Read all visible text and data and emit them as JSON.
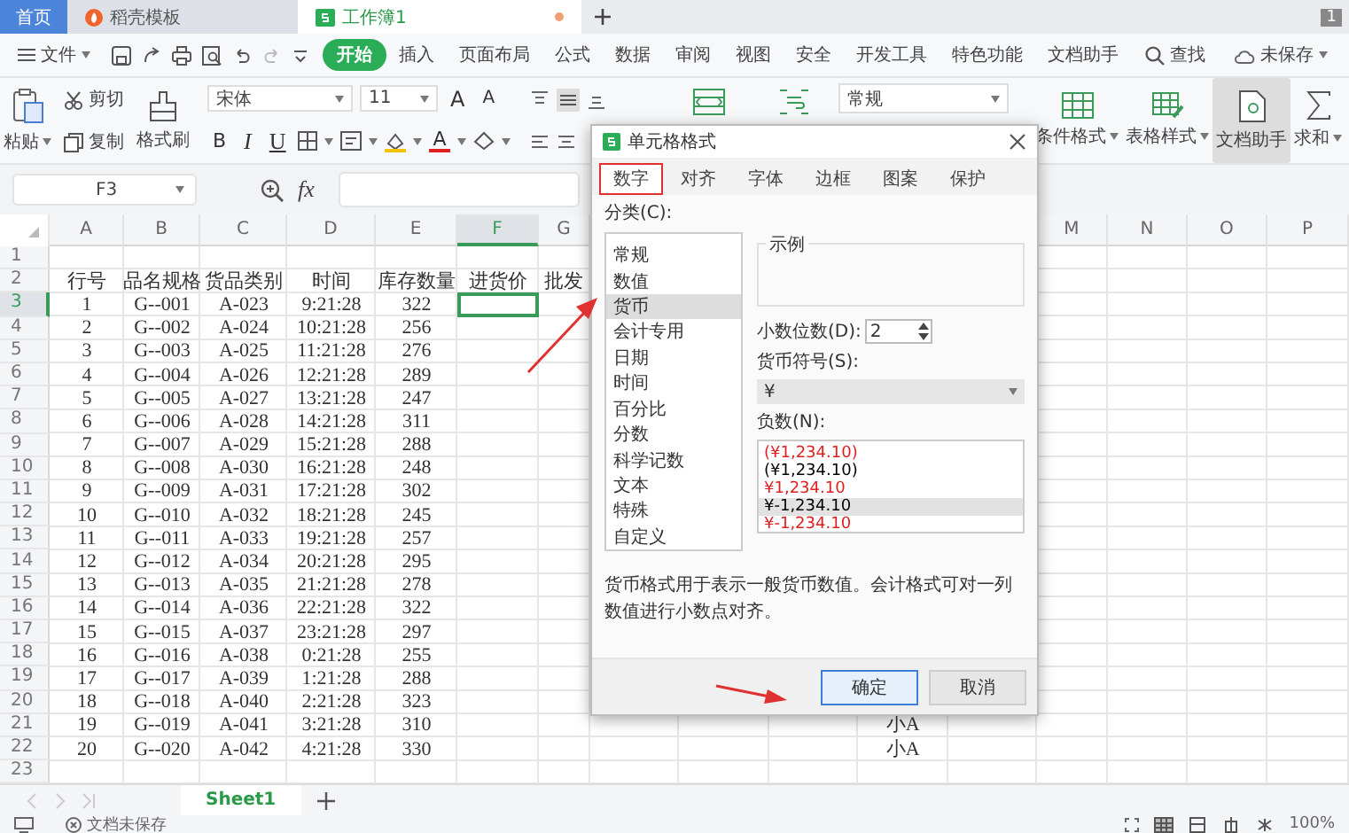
{
  "tabs": [
    {
      "label": "首页",
      "selected": false,
      "kind": "home"
    },
    {
      "label": "稻壳模板",
      "selected": false,
      "kind": "template"
    },
    {
      "label": "工作簿1",
      "selected": true,
      "kind": "sheet"
    }
  ],
  "window_badge": "1",
  "menu": {
    "file": "文件",
    "tabs": [
      {
        "label": "开始",
        "selected": true
      },
      {
        "label": "插入",
        "selected": false
      },
      {
        "label": "页面布局",
        "selected": false
      },
      {
        "label": "公式",
        "selected": false
      },
      {
        "label": "数据",
        "selected": false
      },
      {
        "label": "审阅",
        "selected": false
      },
      {
        "label": "视图",
        "selected": false
      },
      {
        "label": "安全",
        "selected": false
      },
      {
        "label": "开发工具",
        "selected": false
      },
      {
        "label": "特色功能",
        "selected": false
      },
      {
        "label": "文档助手",
        "selected": false
      }
    ],
    "search": "查找",
    "save_status": "未保存"
  },
  "ribbon": {
    "paste": "粘贴",
    "cut": "剪切",
    "copy": "复制",
    "format_painter": "格式刷",
    "font": "宋体",
    "font_size": "11",
    "grow_font": "A",
    "shrink_font": "A",
    "bold": "B",
    "italic": "I",
    "underline": "U",
    "font_color": "A",
    "number_format": "常规",
    "conditional_format": "条件格式",
    "table_style": "表格样式",
    "doc_helper": "文档助手",
    "sum": "求和"
  },
  "formula_bar": {
    "cell": "F3",
    "fx": "fx"
  },
  "grid": {
    "columns": [
      {
        "label": "A",
        "selected": false
      },
      {
        "label": "B",
        "selected": false
      },
      {
        "label": "C",
        "selected": false
      },
      {
        "label": "D",
        "selected": false
      },
      {
        "label": "E",
        "selected": false
      },
      {
        "label": "F",
        "selected": true
      },
      {
        "label": "G",
        "selected": false
      },
      {
        "label": "M",
        "selected": false
      },
      {
        "label": "N",
        "selected": false
      },
      {
        "label": "O",
        "selected": false
      },
      {
        "label": "P",
        "selected": false
      }
    ],
    "rows": [
      {
        "number": "1",
        "selected": false,
        "cells": []
      },
      {
        "number": "2",
        "selected": false,
        "cells": [
          "行号",
          "品名规格",
          "货品类别",
          "时间",
          "库存数量",
          "进货价",
          "批发"
        ]
      },
      {
        "number": "3",
        "selected": true,
        "cells": [
          "1",
          "G--001",
          "A-023",
          "9:21:28",
          "322"
        ]
      },
      {
        "number": "4",
        "selected": false,
        "cells": [
          "2",
          "G--002",
          "A-024",
          "10:21:28",
          "256"
        ]
      },
      {
        "number": "5",
        "selected": false,
        "cells": [
          "3",
          "G--003",
          "A-025",
          "11:21:28",
          "276"
        ]
      },
      {
        "number": "6",
        "selected": false,
        "cells": [
          "4",
          "G--004",
          "A-026",
          "12:21:28",
          "289"
        ]
      },
      {
        "number": "7",
        "selected": false,
        "cells": [
          "5",
          "G--005",
          "A-027",
          "13:21:28",
          "247"
        ]
      },
      {
        "number": "8",
        "selected": false,
        "cells": [
          "6",
          "G--006",
          "A-028",
          "14:21:28",
          "311"
        ]
      },
      {
        "number": "9",
        "selected": false,
        "cells": [
          "7",
          "G--007",
          "A-029",
          "15:21:28",
          "288"
        ]
      },
      {
        "number": "10",
        "selected": false,
        "cells": [
          "8",
          "G--008",
          "A-030",
          "16:21:28",
          "248"
        ]
      },
      {
        "number": "11",
        "selected": false,
        "cells": [
          "9",
          "G--009",
          "A-031",
          "17:21:28",
          "302"
        ]
      },
      {
        "number": "12",
        "selected": false,
        "cells": [
          "10",
          "G--010",
          "A-032",
          "18:21:28",
          "245"
        ]
      },
      {
        "number": "13",
        "selected": false,
        "cells": [
          "11",
          "G--011",
          "A-033",
          "19:21:28",
          "257"
        ]
      },
      {
        "number": "14",
        "selected": false,
        "cells": [
          "12",
          "G--012",
          "A-034",
          "20:21:28",
          "295"
        ]
      },
      {
        "number": "15",
        "selected": false,
        "cells": [
          "13",
          "G--013",
          "A-035",
          "21:21:28",
          "278"
        ]
      },
      {
        "number": "16",
        "selected": false,
        "cells": [
          "14",
          "G--014",
          "A-036",
          "22:21:28",
          "322"
        ]
      },
      {
        "number": "17",
        "selected": false,
        "cells": [
          "15",
          "G--015",
          "A-037",
          "23:21:28",
          "297"
        ]
      },
      {
        "number": "18",
        "selected": false,
        "cells": [
          "16",
          "G--016",
          "A-038",
          "0:21:28",
          "255"
        ]
      },
      {
        "number": "19",
        "selected": false,
        "cells": [
          "17",
          "G--017",
          "A-039",
          "1:21:28",
          "288"
        ]
      },
      {
        "number": "20",
        "selected": false,
        "cells": [
          "18",
          "G--018",
          "A-040",
          "2:21:28",
          "323"
        ]
      },
      {
        "number": "21",
        "selected": false,
        "cells": [
          "19",
          "G--019",
          "A-041",
          "3:21:28",
          "310",
          null,
          null,
          null,
          null,
          null,
          "小A"
        ]
      },
      {
        "number": "22",
        "selected": false,
        "cells": [
          "20",
          "G--020",
          "A-042",
          "4:21:28",
          "330",
          null,
          null,
          null,
          null,
          null,
          "小A"
        ]
      },
      {
        "number": "23",
        "selected": false,
        "cells": []
      }
    ]
  },
  "sheets": [
    {
      "label": "Sheet1",
      "selected": true
    }
  ],
  "status_bar": {
    "doc_status": "文档未保存",
    "zoom": "100%"
  },
  "dialog": {
    "title": "单元格格式",
    "tabs": [
      {
        "label": "数字",
        "selected": true,
        "annotated": true
      },
      {
        "label": "对齐",
        "selected": false,
        "annotated": false
      },
      {
        "label": "字体",
        "selected": false,
        "annotated": false
      },
      {
        "label": "边框",
        "selected": false,
        "annotated": false
      },
      {
        "label": "图案",
        "selected": false,
        "annotated": false
      },
      {
        "label": "保护",
        "selected": false,
        "annotated": false
      }
    ],
    "category_label": "分类(C):",
    "categories": [
      {
        "label": "常规",
        "selected": false
      },
      {
        "label": "数值",
        "selected": false
      },
      {
        "label": "货币",
        "selected": true
      },
      {
        "label": "会计专用",
        "selected": false
      },
      {
        "label": "日期",
        "selected": false
      },
      {
        "label": "时间",
        "selected": false
      },
      {
        "label": "百分比",
        "selected": false
      },
      {
        "label": "分数",
        "selected": false
      },
      {
        "label": "科学记数",
        "selected": false
      },
      {
        "label": "文本",
        "selected": false
      },
      {
        "label": "特殊",
        "selected": false
      },
      {
        "label": "自定义",
        "selected": false
      }
    ],
    "sample_label": "示例",
    "decimals_label": "小数位数(D):",
    "decimals": "2",
    "symbol_label": "货币符号(S):",
    "symbol": "¥",
    "negative_label": "负数(N):",
    "negatives": [
      {
        "text": "(¥1,234.10)",
        "color": "#e02020",
        "selected": false
      },
      {
        "text": "(¥1,234.10)",
        "color": "#000000",
        "selected": false
      },
      {
        "text": "¥1,234.10",
        "color": "#e02020",
        "selected": false
      },
      {
        "text": "¥-1,234.10",
        "color": "#000000",
        "selected": true
      },
      {
        "text": "¥-1,234.10",
        "color": "#e02020",
        "selected": false
      }
    ],
    "description": "货币格式用于表示一般货币数值。会计格式可对一列数值进行小数点对齐。",
    "buttons": [
      {
        "label": "确定",
        "kind": "primary"
      },
      {
        "label": "取消",
        "kind": "secondary"
      }
    ]
  }
}
